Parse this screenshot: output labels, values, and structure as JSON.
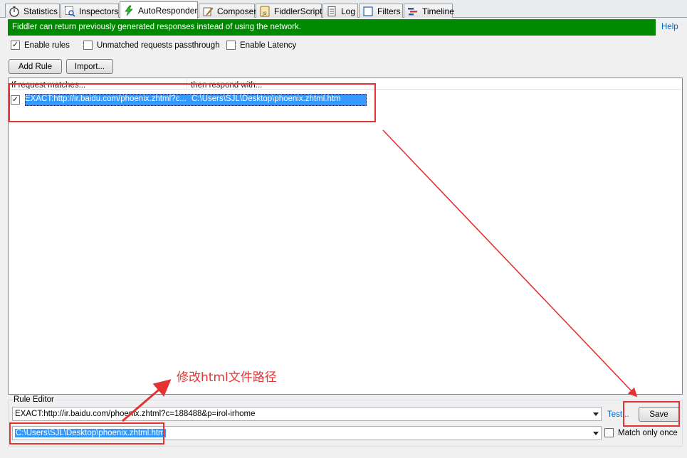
{
  "tabs": [
    {
      "label": "Statistics",
      "icon": "stopwatch-icon"
    },
    {
      "label": "Inspectors",
      "icon": "inspect-icon"
    },
    {
      "label": "AutoResponder",
      "icon": "lightning-icon",
      "active": true
    },
    {
      "label": "Composer",
      "icon": "pencil-icon"
    },
    {
      "label": "FiddlerScript",
      "icon": "script-icon"
    },
    {
      "label": "Log",
      "icon": "log-icon"
    },
    {
      "label": "Filters",
      "icon": "filter-checkbox-icon"
    },
    {
      "label": "Timeline",
      "icon": "timeline-icon"
    }
  ],
  "banner": {
    "text": "Fiddler can return previously generated responses instead of using the network.",
    "color": "#008a00",
    "help_label": "Help"
  },
  "options": {
    "enable_rules": {
      "label": "Enable rules",
      "checked": true
    },
    "unmatched_passthrough": {
      "label": "Unmatched requests passthrough",
      "checked": false
    },
    "enable_latency": {
      "label": "Enable Latency",
      "checked": false
    }
  },
  "buttons": {
    "add_rule": "Add Rule",
    "import": "Import..."
  },
  "rules_list": {
    "columns": [
      "If request matches...",
      "then respond with..."
    ],
    "rows": [
      {
        "checked": true,
        "match": "EXACT:http://ir.baidu.com/phoenix.zhtml?c...",
        "respond": "C:\\Users\\SJL\\Desktop\\phoenix.zhtml.htm"
      }
    ]
  },
  "rule_editor": {
    "title": "Rule Editor",
    "match_value": "EXACT:http://ir.baidu.com/phoenix.zhtml?c=188488&p=irol-irhome",
    "respond_value": "C:\\Users\\SJL\\Desktop\\phoenix.zhtml.htm",
    "test_label": "Test...",
    "save_label": "Save",
    "match_once_label": "Match only once",
    "match_once_checked": false
  },
  "annotation": {
    "text": "修改html文件路径",
    "color": "#e53333"
  }
}
